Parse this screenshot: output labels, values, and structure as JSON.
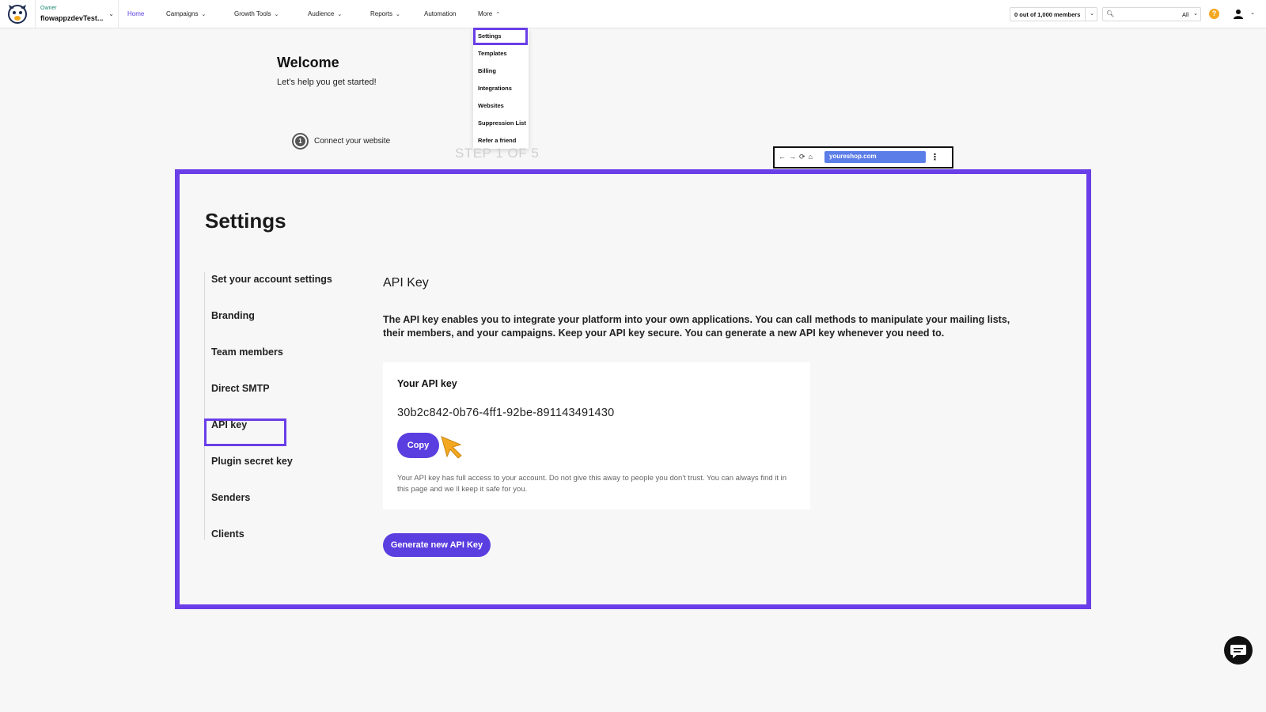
{
  "header": {
    "account_role": "Owner",
    "account_name": "flowappzdevTest...",
    "nav": [
      {
        "label": "Home",
        "active": true,
        "dropdown": false
      },
      {
        "label": "Campaigns",
        "dropdown": true
      },
      {
        "label": "Growth Tools",
        "dropdown": true
      },
      {
        "label": "Audience",
        "dropdown": true
      },
      {
        "label": "Reports",
        "dropdown": true
      },
      {
        "label": "Automation",
        "dropdown": false
      },
      {
        "label": "More",
        "dropdown": true,
        "open": true
      }
    ],
    "members_usage": "0 out of 1,000 members",
    "search_scope": "All",
    "help_label": "?"
  },
  "more_menu": {
    "items": [
      "Settings",
      "Templates",
      "Billing",
      "Integrations",
      "Websites",
      "Suppression List",
      "Refer a friend"
    ],
    "highlighted": "Settings"
  },
  "background": {
    "welcome_title": "Welcome",
    "welcome_subtitle": "Let's help you get started!",
    "step_number": "1",
    "step_label": "Connect your website",
    "step_counter": "STEP 1 OF 5",
    "browser_url": "youreshop.com"
  },
  "settings": {
    "title": "Settings",
    "sidebar": [
      "Set your account settings",
      "Branding",
      "Team members",
      "Direct SMTP",
      "API key",
      "Plugin secret key",
      "Senders",
      "Clients"
    ],
    "active_item": "API key",
    "section_title": "API Key",
    "section_description": "The API key enables you to integrate your platform into your own applications. You can call methods to manipulate your mailing lists, their members, and your campaigns. Keep your API key secure. You can generate a new API key whenever you need to.",
    "card": {
      "title": "Your API key",
      "api_key": "30b2c842-0b76-4ff1-92be-891143491430",
      "copy_label": "Copy",
      "warning": "Your API key has full access to your account. Do not give this away to people you don't trust. You can always find it in this page and we ll keep it safe for you."
    },
    "generate_label": "Generate new API Key"
  },
  "colors": {
    "accent": "#5b3ee0",
    "highlight_border": "#6a3ee8",
    "cursor": "#f4a820",
    "help": "#f4a820"
  }
}
